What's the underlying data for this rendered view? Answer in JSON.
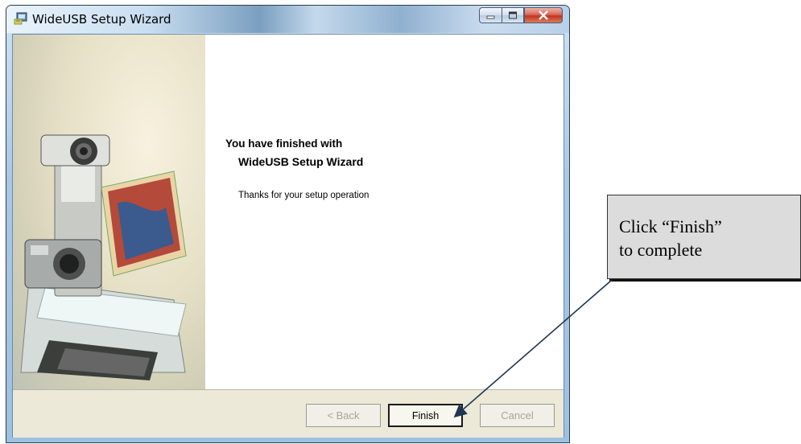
{
  "window": {
    "title": "WideUSB Setup Wizard"
  },
  "content": {
    "heading_line1": "You have finished with",
    "heading_line2": "WideUSB Setup Wizard",
    "subtext": "Thanks for your setup operation"
  },
  "buttons": {
    "back": "< Back",
    "finish": "Finish",
    "cancel": "Cancel"
  },
  "callout": {
    "text_line1": "Click “Finish”",
    "text_line2": "to complete"
  },
  "colors": {
    "callout_bg": "#dcdcdc",
    "arrow": "#1f3552"
  }
}
